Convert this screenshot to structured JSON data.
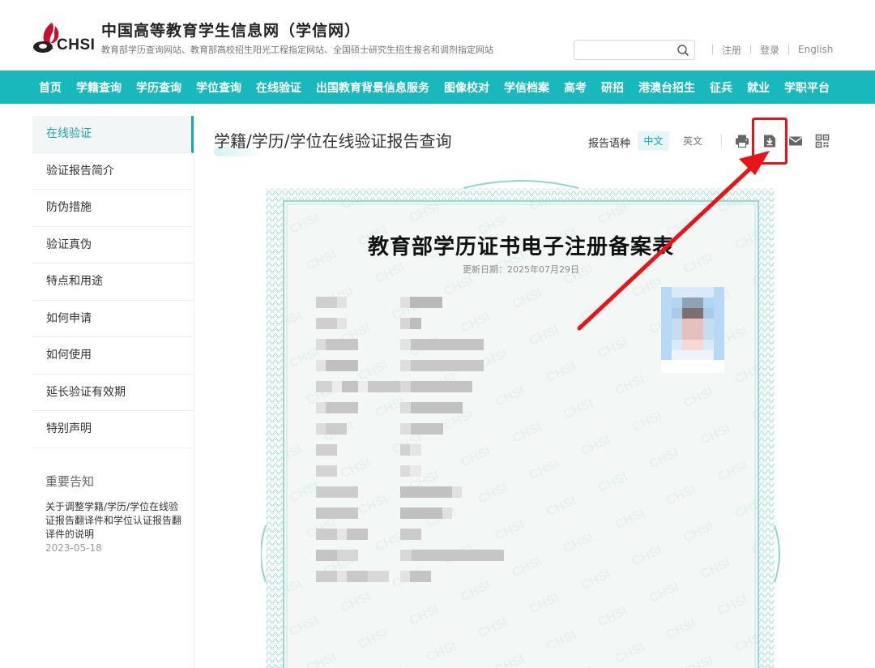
{
  "header": {
    "logo_text": "CHSI",
    "title": "中国高等教育学生信息网（学信网）",
    "subtitle": "教育部学历查询网站、教育部高校招生阳光工程指定网站、全国硕士研究生招生报名和调剂指定网站",
    "search_placeholder": "",
    "links": {
      "register": "注册",
      "login": "登录",
      "english": "English"
    }
  },
  "nav": {
    "items": [
      "首页",
      "学籍查询",
      "学历查询",
      "学位查询",
      "在线验证",
      "出国教育背景信息服务",
      "图像校对",
      "学信档案",
      "高考",
      "研招",
      "港澳台招生",
      "征兵",
      "就业",
      "学职平台"
    ]
  },
  "sidebar": {
    "items": [
      "在线验证",
      "验证报告简介",
      "防伪措施",
      "验证真伪",
      "特点和用途",
      "如何申请",
      "如何使用",
      "延长验证有效期",
      "特别声明"
    ],
    "active_index": 0,
    "notice_title": "重要告知",
    "notice_text": "关于调整学籍/学历/学位在线验证报告翻译件和学位认证报告翻译件的说明",
    "notice_date": "2023-05-18"
  },
  "content": {
    "title": "学籍/学历/学位在线验证报告查询",
    "lang_label": "报告语种",
    "lang_cn": "中文",
    "lang_en": "英文",
    "tools": [
      "print-icon",
      "download-icon",
      "mail-icon",
      "qrcode-icon"
    ]
  },
  "certificate": {
    "title": "教育部学历证书电子注册备案表",
    "date_line": "更新日期：2025年07月29日"
  },
  "colors": {
    "nav_bg": "#18b8bd",
    "accent": "#16a7ad",
    "annotation_red": "#e8141a",
    "cert_border": "#7fd0c4"
  }
}
